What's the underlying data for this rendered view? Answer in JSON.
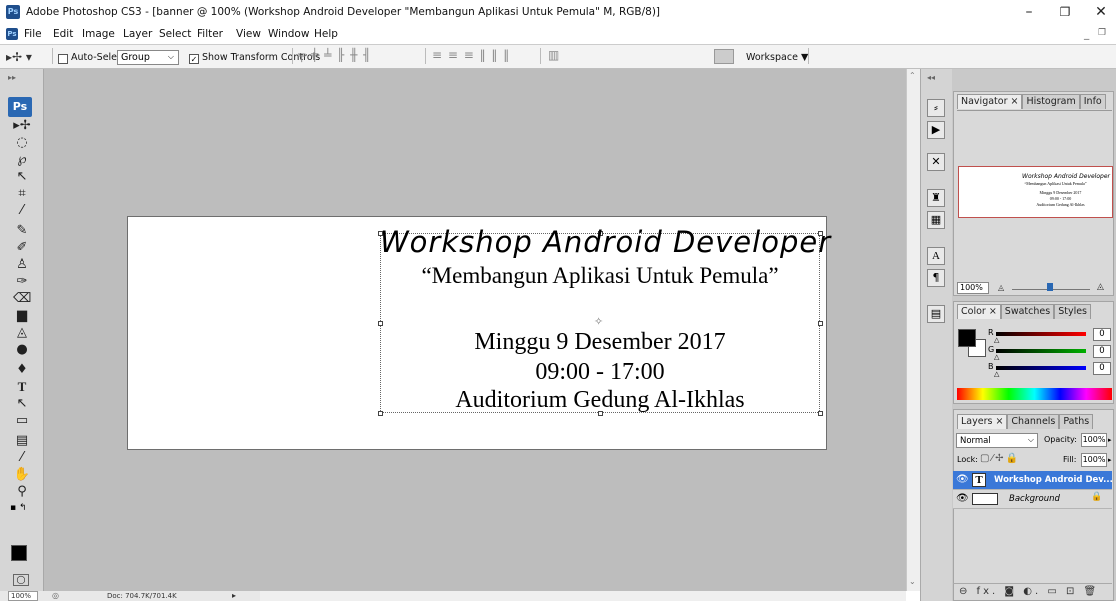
{
  "window": {
    "title": "Adobe Photoshop CS3 - [banner @ 100% (Workshop Android Developer \"Membangun Aplikasi Untuk Pemula\"  M, RGB/8)]",
    "app_icon": "Ps",
    "minimize": "–",
    "restore": "❐",
    "close": "✕"
  },
  "menu": {
    "items": [
      "File",
      "Edit",
      "Image",
      "Layer",
      "Select",
      "Filter",
      "View",
      "Window",
      "Help"
    ],
    "doc_minimize": "_",
    "doc_restore": "❐"
  },
  "options": {
    "auto_select_label": "Auto-Select:",
    "auto_select_value": "Group",
    "show_transform_label": "Show Transform Controls",
    "workspace_label": "Workspace ▼"
  },
  "toolbox": {
    "logo": "Ps"
  },
  "canvas": {
    "heading": "Workshop Android Developer",
    "subtitle": "“Membangun Aplikasi Untuk Pemula”",
    "date": "Minggu 9 Desember 2017",
    "time": "09:00 - 17:00",
    "venue": "Auditorium Gedung Al-Ikhlas"
  },
  "status": {
    "zoom": "100%",
    "doc": "Doc: 704.7K/701.4K"
  },
  "navigator": {
    "tabs": [
      "Navigator",
      "Histogram",
      "Info"
    ],
    "zoom": "100%"
  },
  "color": {
    "tabs": [
      "Color",
      "Swatches",
      "Styles"
    ],
    "channels": [
      {
        "label": "R",
        "value": "0",
        "color": "#ff0000"
      },
      {
        "label": "G",
        "value": "0",
        "color": "#00b000"
      },
      {
        "label": "B",
        "value": "0",
        "color": "#0000ff"
      }
    ]
  },
  "layers": {
    "tabs": [
      "Layers",
      "Channels",
      "Paths"
    ],
    "blend_mode": "Normal",
    "opacity_label": "Opacity:",
    "opacity_value": "100%",
    "lock_label": "Lock:",
    "fill_label": "Fill:",
    "fill_value": "100%",
    "items": [
      {
        "name": "Workshop Android Dev...",
        "type": "text",
        "selected": true
      },
      {
        "name": "Background",
        "type": "background",
        "selected": false
      }
    ],
    "footer_icons": "⊖ fx. ◙ ◐. ▭ ⊡ 🗑"
  },
  "colors": {
    "workspace": "#bdbdbd",
    "selection": "#3a78d8",
    "ps_blue": "#2a68b3"
  }
}
